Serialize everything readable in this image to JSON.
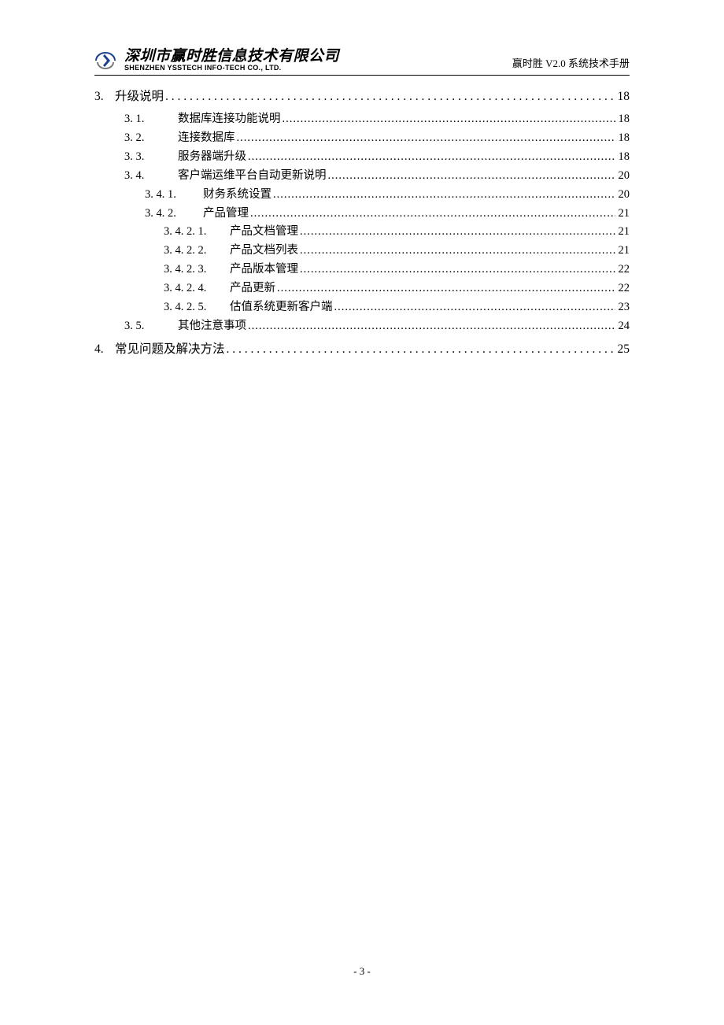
{
  "header": {
    "company_cn": "深圳市赢时胜信息技术有限公司",
    "company_en": "SHENZHEN YSSTECH INFO-TECH CO., LTD.",
    "doc_title": "赢时胜 V2.0 系统技术手册"
  },
  "toc": {
    "sec3": {
      "num": "3.",
      "label": "升级说明",
      "page": "18"
    },
    "sec3_1": {
      "num": "3. 1.",
      "label": "数据库连接功能说明",
      "page": "18"
    },
    "sec3_2": {
      "num": "3. 2.",
      "label": "连接数据库",
      "page": "18"
    },
    "sec3_3": {
      "num": "3. 3.",
      "label": "服务器端升级",
      "page": "18"
    },
    "sec3_4": {
      "num": "3. 4.",
      "label": "客户端运维平台自动更新说明",
      "page": "20"
    },
    "sec3_4_1": {
      "num": "3. 4. 1.",
      "label": "财务系统设置",
      "page": "20"
    },
    "sec3_4_2": {
      "num": "3. 4. 2.",
      "label": "产品管理",
      "page": "21"
    },
    "sec3_4_2_1": {
      "num": "3. 4. 2. 1.",
      "label": "产品文档管理",
      "page": "21"
    },
    "sec3_4_2_2": {
      "num": "3. 4. 2. 2.",
      "label": "产品文档列表",
      "page": "21"
    },
    "sec3_4_2_3": {
      "num": "3. 4. 2. 3.",
      "label": "产品版本管理",
      "page": "22"
    },
    "sec3_4_2_4": {
      "num": "3. 4. 2. 4.",
      "label": "产品更新",
      "page": "22"
    },
    "sec3_4_2_5": {
      "num": "3. 4. 2. 5.",
      "label": "估值系统更新客户端",
      "page": "23"
    },
    "sec3_5": {
      "num": "3. 5.",
      "label": "其他注意事项",
      "page": "24"
    },
    "sec4": {
      "num": "4.",
      "label": "常见问题及解决方法",
      "page": "25"
    }
  },
  "footer": {
    "page_label": "- 3 -"
  }
}
